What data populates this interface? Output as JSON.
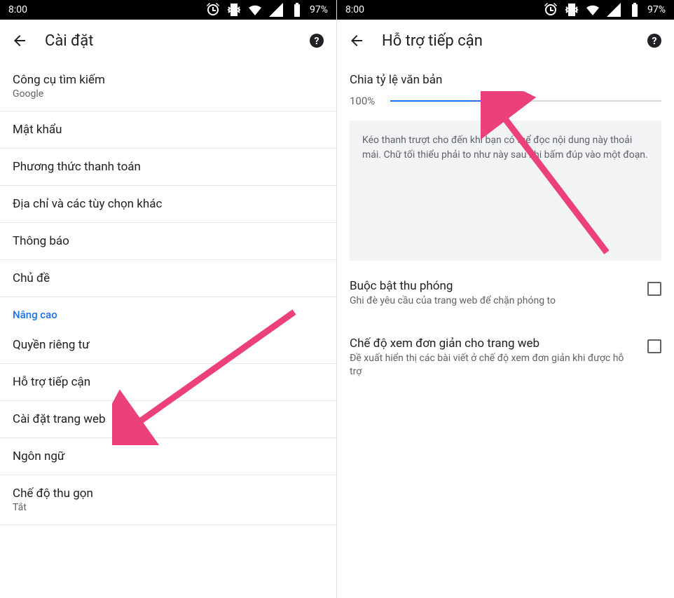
{
  "statusbar": {
    "time": "8:00",
    "battery": "97%"
  },
  "left": {
    "title": "Cài đặt",
    "items": [
      {
        "primary": "Công cụ tìm kiếm",
        "secondary": "Google"
      },
      {
        "primary": "Mật khẩu"
      },
      {
        "primary": "Phương thức thanh toán"
      },
      {
        "primary": "Địa chỉ và các tùy chọn khác"
      },
      {
        "primary": "Thông báo"
      },
      {
        "primary": "Chủ đề"
      }
    ],
    "section": "Nâng cao",
    "advanced": [
      {
        "primary": "Quyền riêng tư"
      },
      {
        "primary": "Hỗ trợ tiếp cận"
      },
      {
        "primary": "Cài đặt trang web"
      },
      {
        "primary": "Ngôn ngữ"
      },
      {
        "primary": "Chế độ thu gọn",
        "secondary": "Tắt"
      }
    ]
  },
  "right": {
    "title": "Hỗ trợ tiếp cận",
    "scale": {
      "label": "Chia tỷ lệ văn bản",
      "value": "100%",
      "percent": 38
    },
    "preview": "Kéo thanh trượt cho đến khi bạn có thể đọc nội dung này thoải mái. Chữ tối thiểu phải to như này sau khi bấm đúp vào một đoạn.",
    "checks": [
      {
        "primary": "Buộc bật thu phóng",
        "secondary": "Ghi đè yêu cầu của trang web để chặn phóng to"
      },
      {
        "primary": "Chế độ xem đơn giản cho trang web",
        "secondary": "Đề xuất hiển thị các bài viết ở chế độ xem đơn giản khi được hỗ trợ"
      }
    ]
  }
}
